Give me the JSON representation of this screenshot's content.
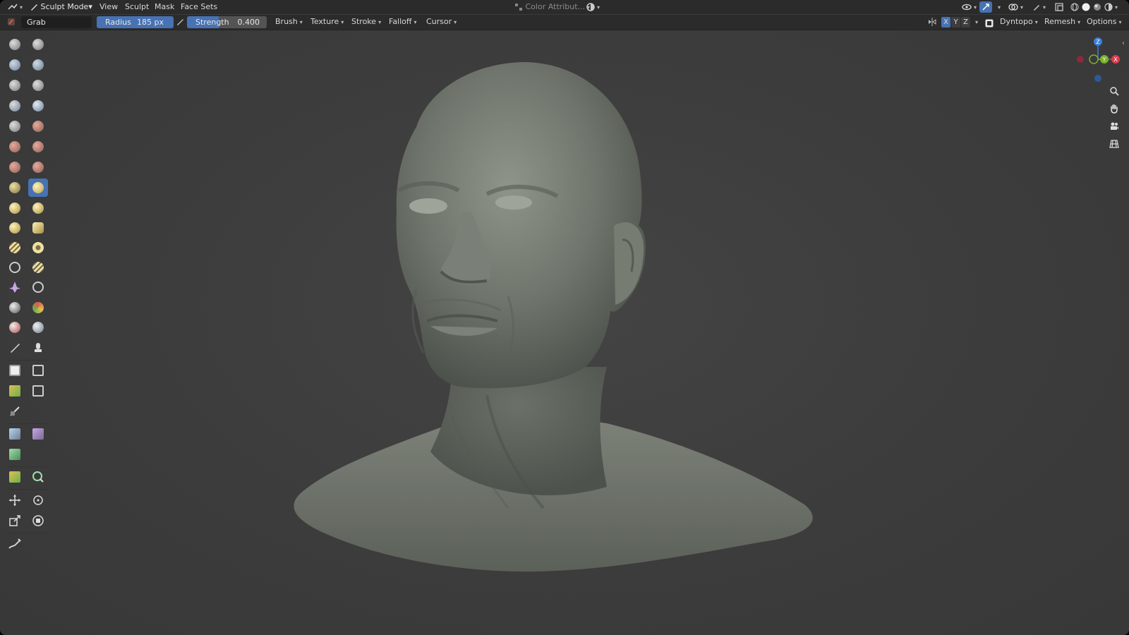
{
  "header": {
    "mode_label": "Sculpt Mode",
    "menu": [
      "View",
      "Sculpt",
      "Mask",
      "Face Sets"
    ],
    "color_attribute_label": "Color Attribut..."
  },
  "tool_settings": {
    "brush_name": "Grab",
    "radius_label": "Radius",
    "radius_value": "185 px",
    "strength_label": "Strength",
    "strength_value": "0.400",
    "strength_fraction": 0.4,
    "dropdowns": [
      "Brush",
      "Texture",
      "Stroke",
      "Falloff",
      "Cursor"
    ],
    "axes": [
      "X",
      "Y",
      "Z"
    ],
    "dyntopo_label": "Dyntopo",
    "remesh_label": "Remesh",
    "options_label": "Options"
  },
  "gizmo": {
    "x_label": "X",
    "y_label": "Y",
    "z_label": "Z"
  },
  "colors": {
    "accent": "#4772b3",
    "x_axis": "#e03a4f",
    "y_axis": "#7bb32e",
    "z_axis": "#3b7fd8"
  }
}
